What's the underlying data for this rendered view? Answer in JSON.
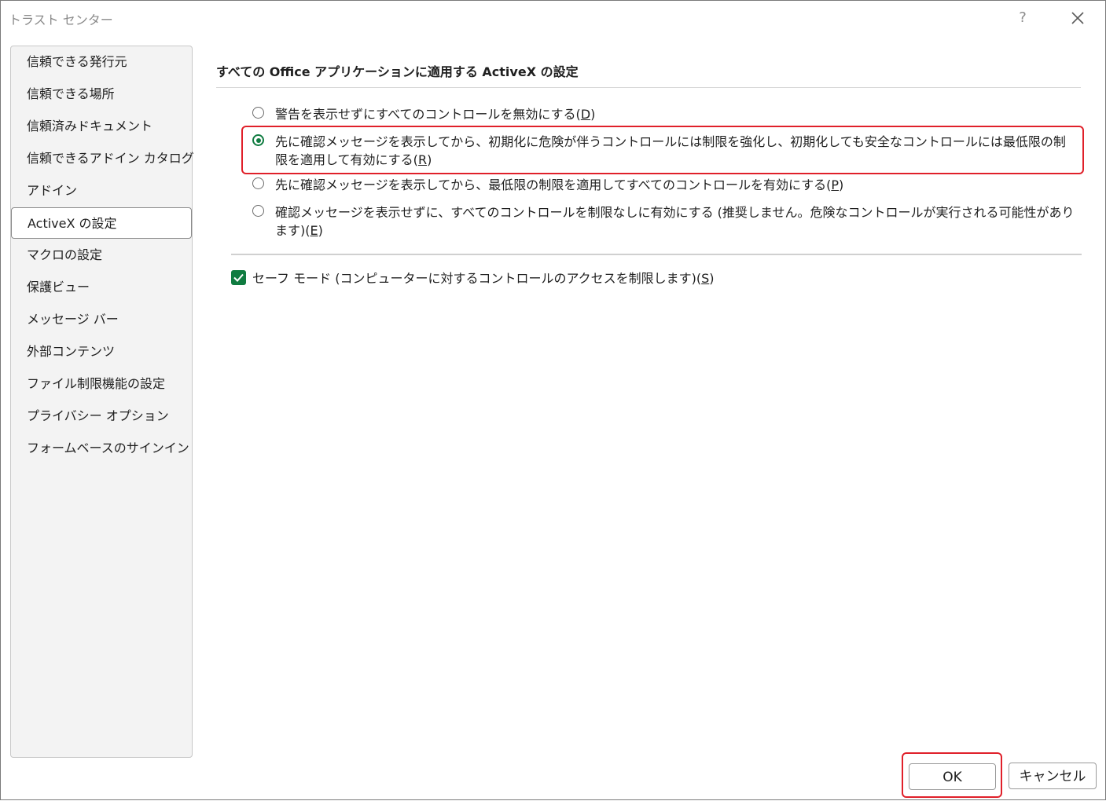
{
  "window": {
    "title": "トラスト センター",
    "help_glyph": "?"
  },
  "sidebar": {
    "items": [
      {
        "label": "信頼できる発行元"
      },
      {
        "label": "信頼できる場所"
      },
      {
        "label": "信頼済みドキュメント"
      },
      {
        "label": "信頼できるアドイン カタログ"
      },
      {
        "label": "アドイン"
      },
      {
        "label": "ActiveX の設定",
        "selected": true
      },
      {
        "label": "マクロの設定"
      },
      {
        "label": "保護ビュー"
      },
      {
        "label": "メッセージ バー"
      },
      {
        "label": "外部コンテンツ"
      },
      {
        "label": "ファイル制限機能の設定"
      },
      {
        "label": "プライバシー オプション"
      },
      {
        "label": "フォームベースのサインイン"
      }
    ]
  },
  "main": {
    "section_title": "すべての Office アプリケーションに適用する ActiveX の設定",
    "options": [
      {
        "text": "警告を表示せずにすべてのコントロールを無効にする(",
        "key": "D",
        "suffix": ")",
        "checked": false
      },
      {
        "text": "先に確認メッセージを表示してから、初期化に危険が伴うコントロールには制限を強化し、初期化しても安全なコントロールには最低限の制限を適用して有効にする(",
        "key": "R",
        "suffix": ")",
        "checked": true
      },
      {
        "text": "先に確認メッセージを表示してから、最低限の制限を適用してすべてのコントロールを有効にする(",
        "key": "P",
        "suffix": ")",
        "checked": false
      },
      {
        "text": "確認メッセージを表示せずに、すべてのコントロールを制限なしに有効にする (推奨しません。危険なコントロールが実行される可能性があります)(",
        "key": "E",
        "suffix": ")",
        "checked": false
      }
    ],
    "safe_mode": {
      "text": "セーフ モード (コンピューターに対するコントロールのアクセスを制限します)(",
      "key": "S",
      "suffix": ")",
      "checked": true
    }
  },
  "footer": {
    "ok_label": "OK",
    "cancel_label": "キャンセル"
  },
  "colors": {
    "accent": "#107c41",
    "highlight": "#e0202a"
  }
}
